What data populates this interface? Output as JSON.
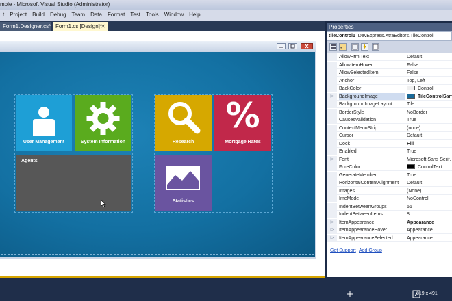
{
  "window": {
    "title": "mple - Microsoft Visual Studio (Administrator)"
  },
  "menu": [
    "t",
    "Project",
    "Build",
    "Debug",
    "Team",
    "Data",
    "Format",
    "Test",
    "Tools",
    "Window",
    "Help"
  ],
  "tabs": [
    {
      "label": "Form1.Designer.cs*"
    },
    {
      "label": "Form1.cs [Design]*",
      "close": "✕"
    }
  ],
  "tiles": {
    "user_management": {
      "label": "User Management",
      "color": "#1e9fd6"
    },
    "system_information": {
      "label": "System Information",
      "color": "#5aab1e"
    },
    "agents": {
      "label": "Agents",
      "color": "#575757"
    },
    "research": {
      "label": "Research",
      "color": "#d6a800"
    },
    "mortgage_rates": {
      "label": "Mortgage Rates",
      "color": "#c1284a",
      "glyph": "%"
    },
    "statistics": {
      "label": "Statistics",
      "color": "#6a54a0"
    }
  },
  "properties": {
    "title": "Properties",
    "object_name": "tileControl1",
    "object_type": "DevExpress.XtraEditors.TileControl",
    "rows": [
      {
        "name": "AllowHtmlText",
        "value": "Default"
      },
      {
        "name": "AllowItemHover",
        "value": "False"
      },
      {
        "name": "AllowSelectedItem",
        "value": "False"
      },
      {
        "name": "Anchor",
        "value": "Top, Left"
      },
      {
        "name": "BackColor",
        "value": "Control",
        "swatch": "#f0f0f0"
      },
      {
        "name": "BackgroundImage",
        "value": "TileControlSam",
        "swatch": "#1a6a99",
        "expand": "▷",
        "bold": true
      },
      {
        "name": "BackgroundImageLayout",
        "value": "Tile"
      },
      {
        "name": "BorderStyle",
        "value": "NoBorder"
      },
      {
        "name": "CausesValidation",
        "value": "True"
      },
      {
        "name": "ContextMenuStrip",
        "value": "(none)"
      },
      {
        "name": "Cursor",
        "value": "Default"
      },
      {
        "name": "Dock",
        "value": "Fill",
        "bold": true
      },
      {
        "name": "Enabled",
        "value": "True"
      },
      {
        "name": "Font",
        "value": "Microsoft Sans Serif,",
        "expand": "▷"
      },
      {
        "name": "ForeColor",
        "value": "ControlText",
        "swatch": "#000000"
      },
      {
        "name": "GenerateMember",
        "value": "True"
      },
      {
        "name": "HorizontalContentAlignment",
        "value": "Default"
      },
      {
        "name": "Images",
        "value": "(None)"
      },
      {
        "name": "ImeMode",
        "value": "NoControl"
      },
      {
        "name": "IndentBetweenGroups",
        "value": "56"
      },
      {
        "name": "IndentBetweenItems",
        "value": "8"
      },
      {
        "name": "ItemAppearance",
        "value": "Appearance",
        "expand": "▷",
        "bold": true
      },
      {
        "name": "ItemAppearanceHover",
        "value": "Appearance",
        "expand": "▷"
      },
      {
        "name": "ItemAppearanceSelected",
        "value": "Appearance",
        "expand": "▷"
      }
    ],
    "links": {
      "support": "Get Support",
      "add_group": "Add Group"
    }
  },
  "status": {
    "size": "819 x 491"
  }
}
